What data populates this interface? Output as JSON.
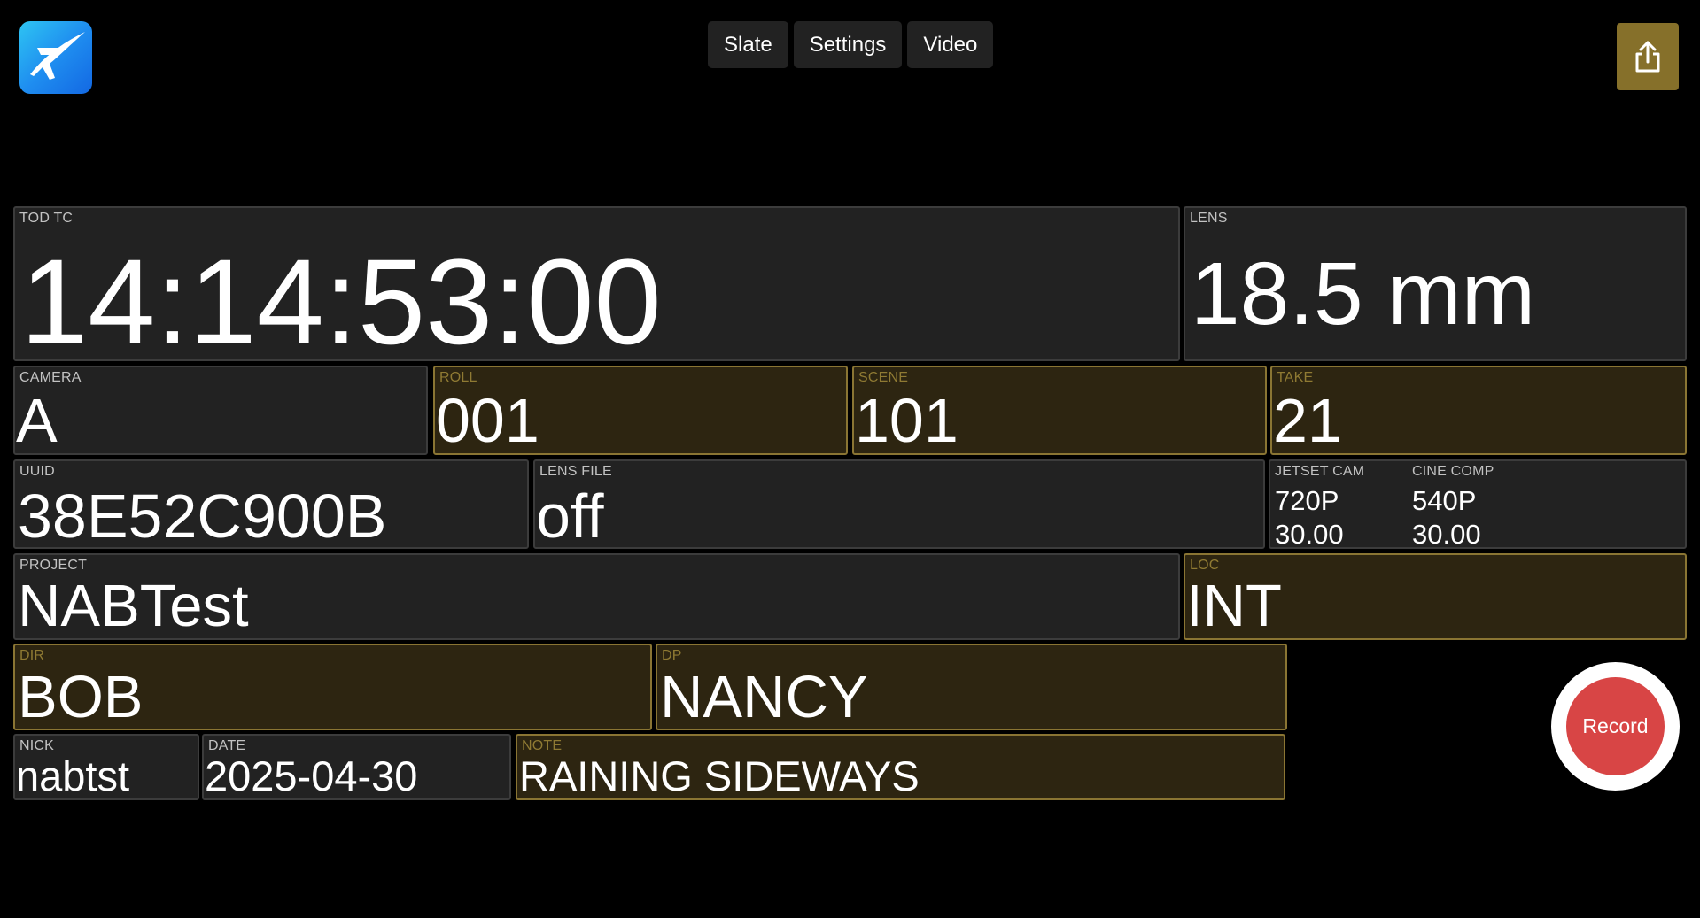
{
  "nav": {
    "tabs": [
      "Slate",
      "Settings",
      "Video"
    ]
  },
  "icons": {
    "logo": "airplane-logo-icon",
    "share": "share-icon"
  },
  "colors": {
    "accent_gold": "#86702a",
    "record_red": "#d84545",
    "logo_blue": "#1f8ef0"
  },
  "slate": {
    "tod_tc": {
      "label": "TOD TC",
      "value": "14:14:53:00"
    },
    "lens": {
      "label": "LENS",
      "value": "18.5 mm"
    },
    "camera": {
      "label": "CAMERA",
      "value": "A"
    },
    "roll": {
      "label": "ROLL",
      "value": "001"
    },
    "scene": {
      "label": "SCENE",
      "value": "101"
    },
    "take": {
      "label": "TAKE",
      "value": "21"
    },
    "uuid": {
      "label": "UUID",
      "value": "38E52C900B"
    },
    "lens_file": {
      "label": "LENS FILE",
      "value": "off"
    },
    "jetset_cam": {
      "label": "JETSET CAM",
      "resolution": "720P",
      "fps": "30.00"
    },
    "cine_comp": {
      "label": "CINE COMP",
      "resolution": "540P",
      "fps": "30.00"
    },
    "project": {
      "label": "PROJECT",
      "value": "NABTest"
    },
    "loc": {
      "label": "LOC",
      "value": "INT"
    },
    "dir": {
      "label": "DIR",
      "value": "BOB"
    },
    "dp": {
      "label": "DP",
      "value": "NANCY"
    },
    "nick": {
      "label": "NICK",
      "value": "nabtst"
    },
    "date": {
      "label": "DATE",
      "value": "2025-04-30"
    },
    "note": {
      "label": "NOTE",
      "value": "RAINING SIDEWAYS"
    }
  },
  "record": {
    "label": "Record"
  }
}
